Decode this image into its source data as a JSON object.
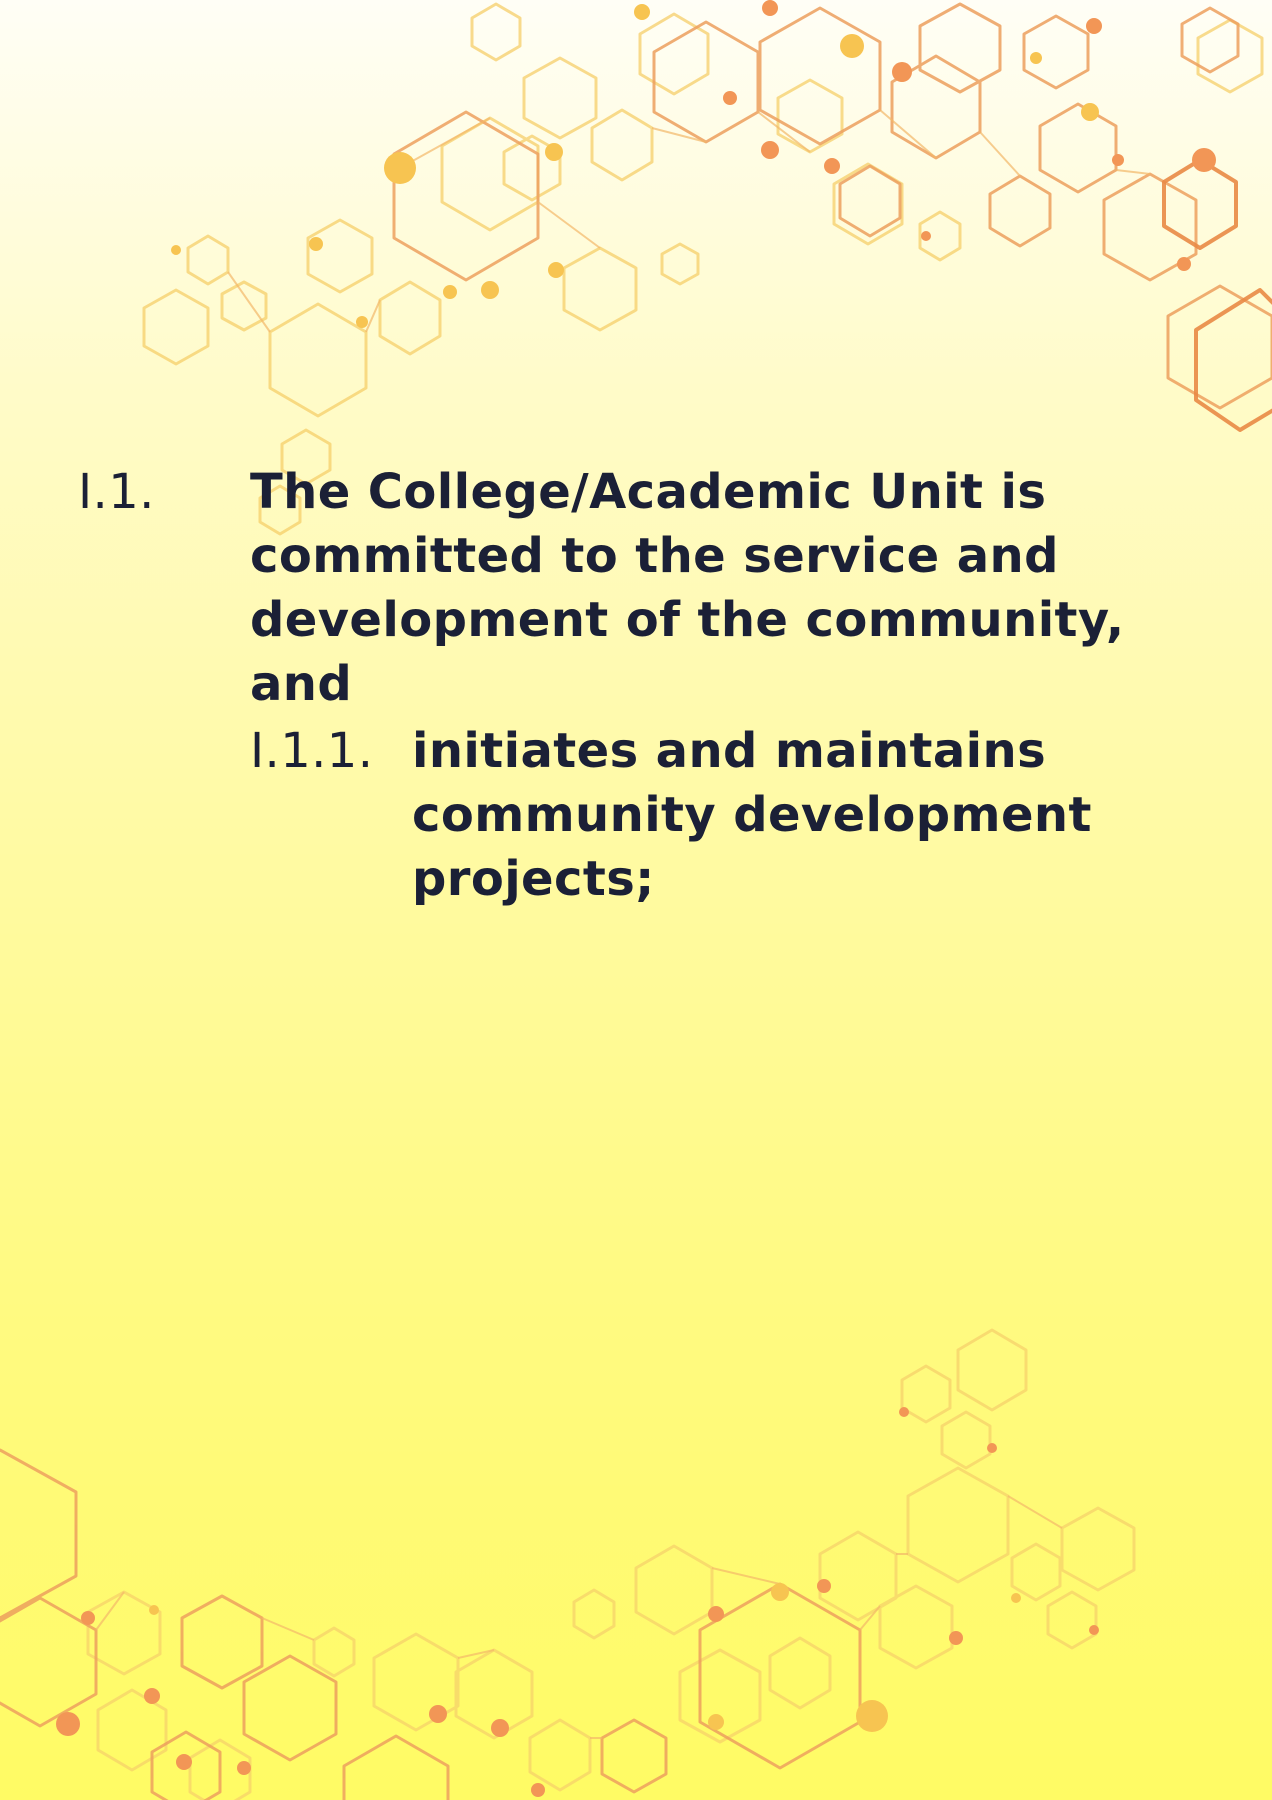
{
  "sections": [
    {
      "number": "I.1.",
      "lines": [
        "The College/Academic Unit is",
        "committed to the service and",
        "development of the community, and"
      ]
    },
    {
      "number": "I.1.1.",
      "lines": [
        "initiates and maintains",
        "community development",
        "projects;"
      ]
    }
  ],
  "colors": {
    "text": "#1b2036",
    "background_top": "#fffef6",
    "background_bottom": "#fffb64",
    "hex_light": "#f7c94f",
    "hex_dark": "#ec9a56"
  }
}
